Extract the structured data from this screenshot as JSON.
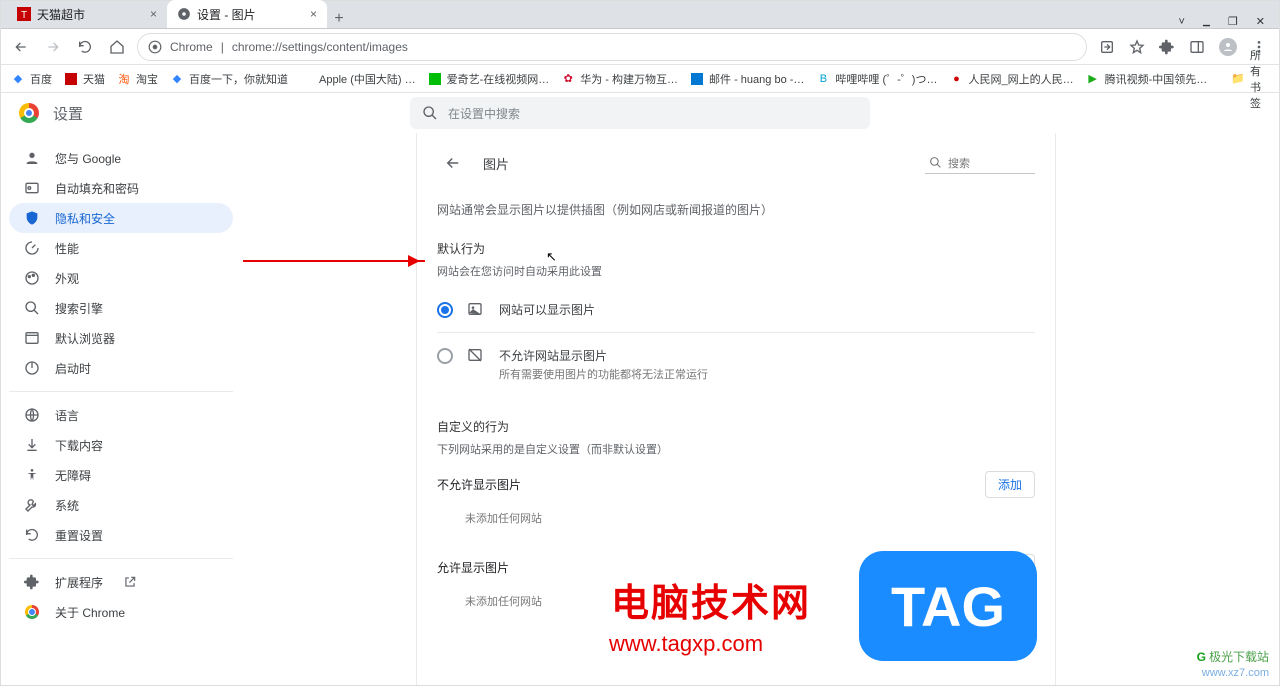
{
  "window": {
    "min": "▁",
    "restore": "❐",
    "close": "✕",
    "chevron": "˅"
  },
  "tabs": [
    {
      "title": "天猫超市",
      "active": false
    },
    {
      "title": "设置 - 图片",
      "active": true
    }
  ],
  "newtab": "+",
  "addr": {
    "secure_prefix": "Chrome",
    "separator": "|",
    "url": "chrome://settings/content/images"
  },
  "bookmarks": [
    {
      "label": "百度",
      "color": "#3385ff"
    },
    {
      "label": "天猫",
      "color": "#c40000"
    },
    {
      "label": "淘宝",
      "color": "#ff5000"
    },
    {
      "label": "百度一下，你就知道",
      "color": "#3385ff"
    },
    {
      "label": "Apple (中国大陆) …",
      "color": "#000"
    },
    {
      "label": "爱奇艺-在线视频网…",
      "color": "#00be06"
    },
    {
      "label": "华为 - 构建万物互…",
      "color": "#cf0a2c"
    },
    {
      "label": "邮件 - huang bo -…",
      "color": "#0078d4"
    },
    {
      "label": "哔哩哔哩 (゜-゜)つ…",
      "color": "#00a1d6"
    },
    {
      "label": "人民网_网上的人民…",
      "color": "#cc0000"
    },
    {
      "label": "腾讯视频-中国领先…",
      "color": "#1aad19"
    }
  ],
  "bookmarks_all": "所有书签",
  "settings": {
    "title": "设置",
    "search_placeholder": "在设置中搜索",
    "sidebar": [
      {
        "name": "you-and-google",
        "label": "您与 Google",
        "icon": "person"
      },
      {
        "name": "autofill",
        "label": "自动填充和密码",
        "icon": "autofill"
      },
      {
        "name": "privacy",
        "label": "隐私和安全",
        "icon": "shield",
        "selected": true
      },
      {
        "name": "performance",
        "label": "性能",
        "icon": "speed"
      },
      {
        "name": "appearance",
        "label": "外观",
        "icon": "paint"
      },
      {
        "name": "search-engine",
        "label": "搜索引擎",
        "icon": "search"
      },
      {
        "name": "default-browser",
        "label": "默认浏览器",
        "icon": "browser"
      },
      {
        "name": "on-startup",
        "label": "启动时",
        "icon": "power"
      }
    ],
    "sidebar2": [
      {
        "name": "languages",
        "label": "语言",
        "icon": "globe"
      },
      {
        "name": "downloads",
        "label": "下载内容",
        "icon": "download"
      },
      {
        "name": "accessibility",
        "label": "无障碍",
        "icon": "a11y"
      },
      {
        "name": "system",
        "label": "系统",
        "icon": "wrench"
      },
      {
        "name": "reset",
        "label": "重置设置",
        "icon": "reset"
      }
    ],
    "sidebar3": [
      {
        "name": "extensions",
        "label": "扩展程序",
        "icon": "ext",
        "external": true
      },
      {
        "name": "about",
        "label": "关于 Chrome",
        "icon": "chrome"
      }
    ]
  },
  "content": {
    "page_title": "图片",
    "search_placeholder": "搜索",
    "intro": "网站通常会显示图片以提供插图（例如网店或新闻报道的图片）",
    "default_title": "默认行为",
    "default_sub": "网站会在您访问时自动采用此设置",
    "radio1": {
      "label": "网站可以显示图片"
    },
    "radio2": {
      "label": "不允许网站显示图片",
      "sub": "所有需要使用图片的功能都将无法正常运行"
    },
    "custom_title": "自定义的行为",
    "custom_sub": "下列网站采用的是自定义设置（而非默认设置）",
    "block_title": "不允许显示图片",
    "allow_title": "允许显示图片",
    "add_btn": "添加",
    "empty": "未添加任何网站"
  },
  "watermark": {
    "line1": "电脑技术网",
    "line2": "www.tagxp.com",
    "tag": "TAG",
    "site_name": "极光下载站",
    "site_url": "www.xz7.com"
  },
  "colors": {
    "accent": "#1a73e8",
    "link": "#1967d2"
  }
}
